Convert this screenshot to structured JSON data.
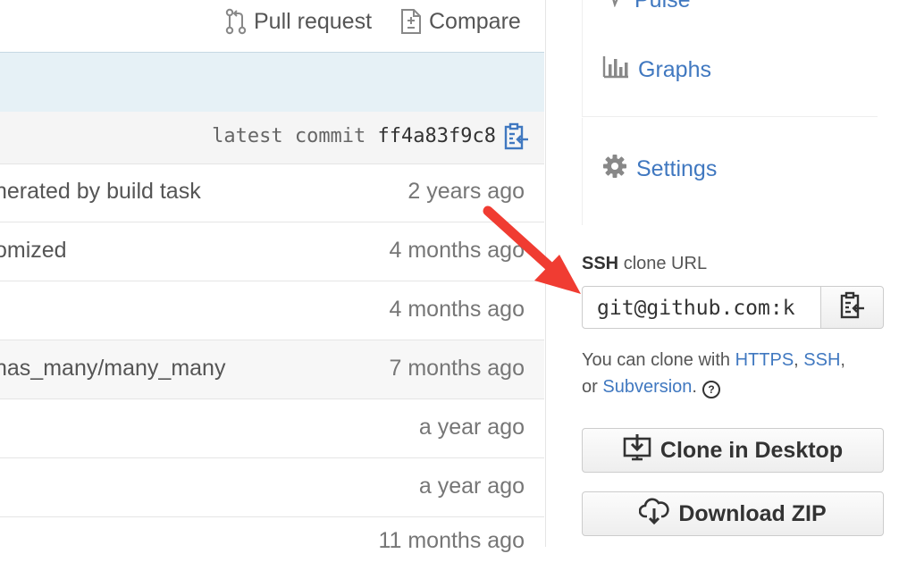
{
  "toolbar": {
    "pull_request_label": "Pull request",
    "compare_label": "Compare"
  },
  "commit_bar": {
    "prefix": "latest commit",
    "sha": "ff4a83f9c8"
  },
  "file_rows": [
    {
      "message": "nerated by build task",
      "age": "2 years ago"
    },
    {
      "message": "omized",
      "age": "4 months ago"
    },
    {
      "message": "",
      "age": "4 months ago"
    },
    {
      "message": "has_many/many_many",
      "age": "7 months ago"
    },
    {
      "message": "",
      "age": "a year ago"
    },
    {
      "message": "",
      "age": "a year ago"
    },
    {
      "message": "",
      "age": "11 months ago"
    }
  ],
  "sidebar": {
    "pulse_label": "Pulse",
    "graphs_label": "Graphs",
    "settings_label": "Settings"
  },
  "clone": {
    "protocol": "SSH",
    "label_suffix": "clone URL",
    "url": "git@github.com:k",
    "help_prefix": "You can clone with",
    "link_https": "HTTPS",
    "sep1": ",",
    "link_ssh": "SSH",
    "sep2": ",",
    "or_text": "or",
    "link_subversion": "Subversion",
    "end_punct": ".",
    "help_icon_glyph": "?"
  },
  "buttons": {
    "clone_desktop": "Clone in Desktop",
    "download_zip": "Download ZIP"
  },
  "colors": {
    "link": "#4078c0",
    "annotation_arrow": "#f03c32",
    "description_bar": "#e6f1f6"
  },
  "icons": [
    "pull-request-icon",
    "compare-icon",
    "clipboard-icon",
    "pulse-icon",
    "graph-icon",
    "gear-icon",
    "help-icon",
    "desktop-download-icon",
    "cloud-download-icon",
    "arrow-annotation"
  ]
}
